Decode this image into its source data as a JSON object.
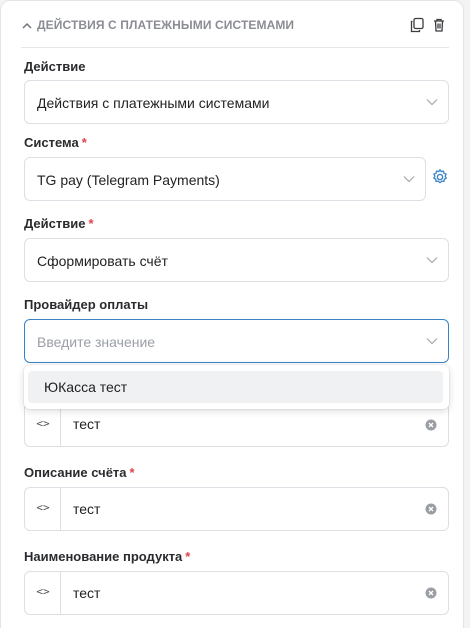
{
  "block": {
    "title": "ДЕЙСТВИЯ С ПЛАТЕЖНЫМИ СИСТЕМАМИ",
    "icons": [
      "chevron-up-icon",
      "copy-icon",
      "trash-icon"
    ]
  },
  "fields": {
    "action": {
      "label": "Действие",
      "value": "Действия с платежными системами"
    },
    "system": {
      "label": "Система",
      "required_mark": "*",
      "value": "TG pay (Telegram Payments)"
    },
    "operation": {
      "label": "Действие",
      "required_mark": "*",
      "value": "Сформировать счёт"
    },
    "provider": {
      "label": "Провайдер оплаты",
      "placeholder": "Введите значение",
      "options": [
        "ЮКасса тест"
      ]
    },
    "hidden_field": {
      "value": "тест",
      "prefix": "<>"
    },
    "invoice_description": {
      "label": "Описание счёта",
      "required_mark": "*",
      "value": "тест",
      "prefix": "<>"
    },
    "product_name": {
      "label": "Наименование продукта",
      "required_mark": "*",
      "value": "тест",
      "prefix": "<>"
    }
  },
  "colors": {
    "accent": "#3b82c4",
    "required": "#e0424a"
  }
}
